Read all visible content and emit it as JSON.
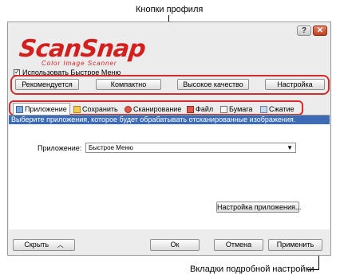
{
  "callouts": {
    "profile_buttons": "Кнопки профиля",
    "detail_tabs": "Вкладки подробной настройки"
  },
  "titlebar": {
    "help_icon": "?",
    "close_icon": "✕"
  },
  "logo": {
    "name": "ScanSnap",
    "tagline": "Color Image Scanner"
  },
  "quick_menu": {
    "label": "Использовать Быстрое Меню",
    "checked": true
  },
  "profiles": [
    "Рекомендуется",
    "Компактно",
    "Высокое качество",
    "Настройка"
  ],
  "tabs": [
    {
      "label": "Приложение",
      "icon": "application-icon",
      "active": true
    },
    {
      "label": "Сохранить",
      "icon": "folder-icon"
    },
    {
      "label": "Сканирование",
      "icon": "scan-icon"
    },
    {
      "label": "Файл",
      "icon": "file-icon"
    },
    {
      "label": "Бумага",
      "icon": "paper-icon"
    },
    {
      "label": "Сжатие",
      "icon": "compression-icon"
    }
  ],
  "description": "Выберите приложения, которое будет обрабатывать отсканированные изображения.",
  "application": {
    "label": "Приложение:",
    "selected": "Быстрое Меню",
    "settings_button": "Настройка приложения..."
  },
  "footer": {
    "hide": "Скрыть",
    "ok": "Ок",
    "cancel": "Отмена",
    "apply": "Применить"
  },
  "colors": {
    "accent_red": "#d42b2b",
    "description_bar": "#3d6cb4",
    "logo": "#d41f1f"
  }
}
